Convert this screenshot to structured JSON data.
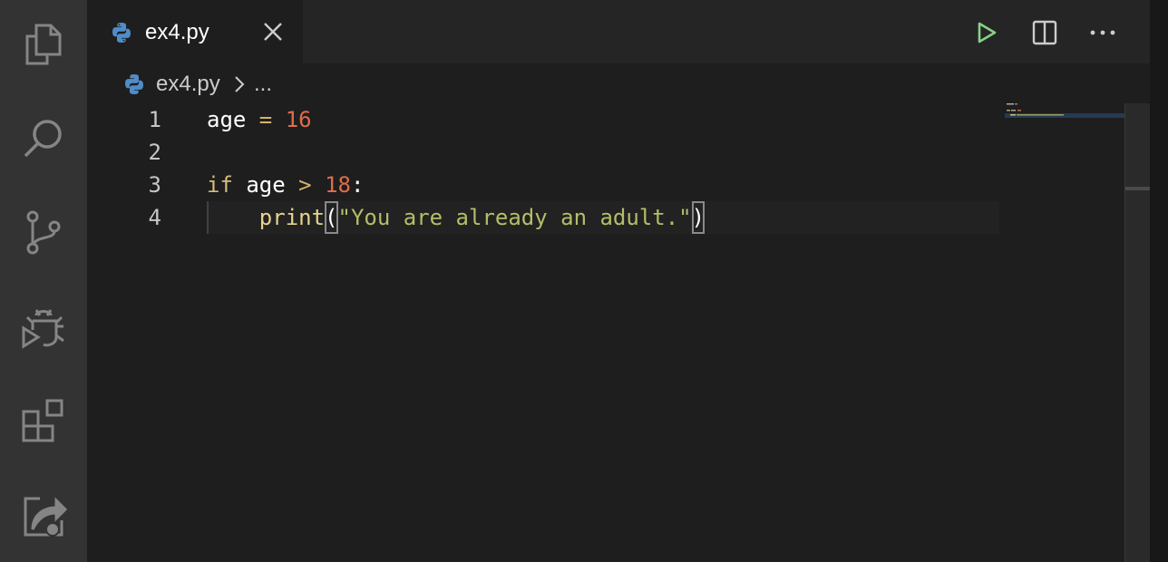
{
  "activity_bar": {
    "items": [
      {
        "name": "explorer",
        "icon": "files-icon"
      },
      {
        "name": "search",
        "icon": "search-icon"
      },
      {
        "name": "source-control",
        "icon": "source-control-icon"
      },
      {
        "name": "run-and-debug",
        "icon": "run-debug-icon"
      },
      {
        "name": "extensions",
        "icon": "extensions-icon"
      },
      {
        "name": "remote-explorer",
        "icon": "remote-explorer-icon"
      }
    ]
  },
  "tabs": [
    {
      "label": "ex4.py",
      "icon": "python-icon",
      "active": true
    }
  ],
  "toolbar": {
    "run_icon": "run-python-file-icon",
    "split_icon": "split-editor-icon",
    "more_icon": "more-actions-icon"
  },
  "breadcrumb": {
    "file": "ex4.py",
    "more": "..."
  },
  "editor": {
    "line_numbers": [
      "1",
      "2",
      "3",
      "4"
    ],
    "code": {
      "line1": {
        "var": "age",
        "op": " = ",
        "num": "16"
      },
      "line3": {
        "kw": "if",
        "var": "age",
        "op": " > ",
        "num": "18",
        "colon": ":"
      },
      "line4": {
        "indent": "    ",
        "fn": "print",
        "open": "(",
        "str": "\"You are already an adult.\"",
        "close": ")"
      }
    }
  },
  "colors": {
    "activity_bar_bg": "#333333",
    "editor_bg": "#1e1e1e",
    "number": "#e06c4a",
    "string": "#b5bd68",
    "keyword": "#d7ba7d",
    "run_green": "#89d185"
  }
}
